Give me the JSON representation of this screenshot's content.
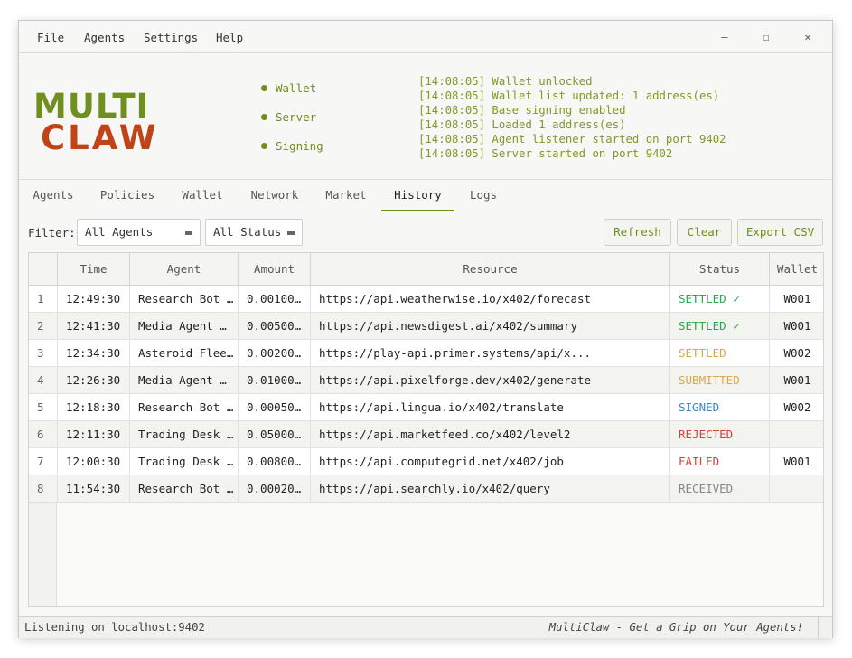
{
  "menu": {
    "file": "File",
    "agents": "Agents",
    "settings": "Settings",
    "help": "Help"
  },
  "window_controls": {
    "minimize": "—",
    "maximize": "☐",
    "close": "✕"
  },
  "logo": {
    "line1": "MULTI",
    "line2": "CLAW",
    "color1": "#6f8f1f",
    "color2": "#c04418"
  },
  "status_indicators": [
    {
      "label": "Wallet"
    },
    {
      "label": "Server"
    },
    {
      "label": "Signing"
    }
  ],
  "log": [
    "[14:08:05] Wallet unlocked",
    "[14:08:05] Wallet list updated: 1 address(es)",
    "[14:08:05] Base signing enabled",
    "[14:08:05] Loaded 1 address(es)",
    "[14:08:05] Agent listener started on port 9402",
    "[14:08:05] Server started on port 9402"
  ],
  "tabs": [
    {
      "label": "Agents"
    },
    {
      "label": "Policies"
    },
    {
      "label": "Wallet"
    },
    {
      "label": "Network"
    },
    {
      "label": "Market"
    },
    {
      "label": "History",
      "active": true
    },
    {
      "label": "Logs"
    }
  ],
  "filter": {
    "label": "Filter:",
    "agent_select": "All Agents",
    "status_select": "All Status"
  },
  "buttons": {
    "refresh": "Refresh",
    "clear": "Clear",
    "export": "Export CSV"
  },
  "table": {
    "columns": [
      "",
      "Time",
      "Agent",
      "Amount",
      "Resource",
      "Status",
      "Wallet"
    ],
    "rows": [
      {
        "n": "1",
        "time": "12:49:30",
        "agent": "Research Bot …",
        "amount": "0.00100…",
        "resource": "https://api.weatherwise.io/x402/forecast",
        "status": "SETTLED ✓",
        "status_color": "#2aa84a",
        "wallet": "W001"
      },
      {
        "n": "2",
        "time": "12:41:30",
        "agent": "Media Agent …",
        "amount": "0.00500…",
        "resource": "https://api.newsdigest.ai/x402/summary",
        "status": "SETTLED ✓",
        "status_color": "#2aa84a",
        "wallet": "W001"
      },
      {
        "n": "3",
        "time": "12:34:30",
        "agent": "Asteroid Flee…",
        "amount": "0.00200…",
        "resource": "https://play-api.primer.systems/api/x...",
        "status": "SETTLED",
        "status_color": "#d9a84a",
        "wallet": "W002"
      },
      {
        "n": "4",
        "time": "12:26:30",
        "agent": "Media Agent …",
        "amount": "0.01000…",
        "resource": "https://api.pixelforge.dev/x402/generate",
        "status": "SUBMITTED",
        "status_color": "#d9a84a",
        "wallet": "W001"
      },
      {
        "n": "5",
        "time": "12:18:30",
        "agent": "Research Bot …",
        "amount": "0.00050…",
        "resource": "https://api.lingua.io/x402/translate",
        "status": "SIGNED",
        "status_color": "#3a86c8",
        "wallet": "W002"
      },
      {
        "n": "6",
        "time": "12:11:30",
        "agent": "Trading Desk …",
        "amount": "0.05000…",
        "resource": "https://api.marketfeed.co/x402/level2",
        "status": "REJECTED",
        "status_color": "#d0433a",
        "wallet": ""
      },
      {
        "n": "7",
        "time": "12:00:30",
        "agent": "Trading Desk …",
        "amount": "0.00800…",
        "resource": "https://api.computegrid.net/x402/job",
        "status": "FAILED",
        "status_color": "#d0433a",
        "wallet": "W001"
      },
      {
        "n": "8",
        "time": "11:54:30",
        "agent": "Research Bot …",
        "amount": "0.00020…",
        "resource": "https://api.searchly.io/x402/query",
        "status": "RECEIVED",
        "status_color": "#888888",
        "wallet": ""
      }
    ]
  },
  "statusbar": {
    "left": "Listening on localhost:9402",
    "right": "MultiClaw - Get a Grip on Your Agents!"
  },
  "colors": {
    "accent": "#6f8f1f",
    "log_text": "#7d9a2a"
  }
}
